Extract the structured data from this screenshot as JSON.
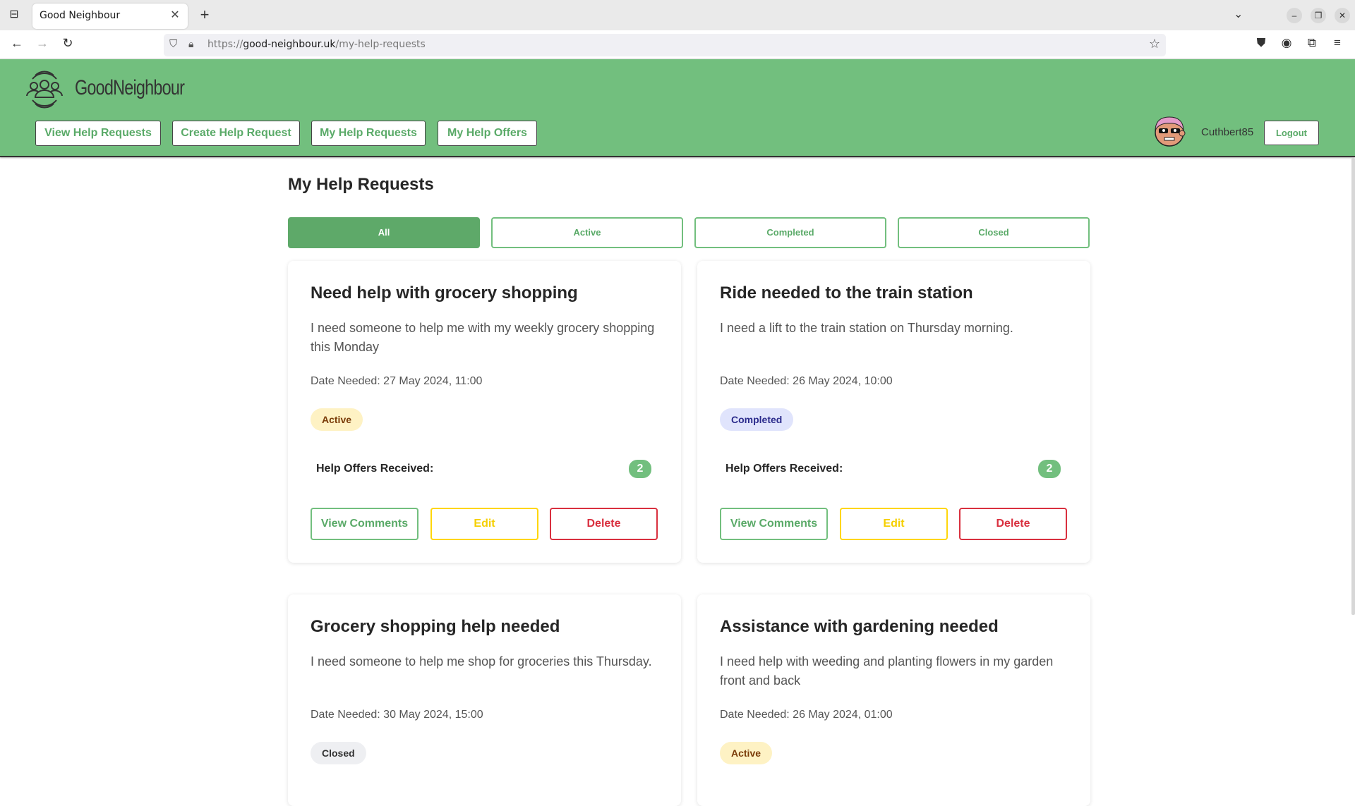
{
  "browser": {
    "tab_title": "Good Neighbour",
    "url_scheme": "https://",
    "url_host": "good-neighbour.uk",
    "url_path": "/my-help-requests"
  },
  "header": {
    "brand": "GoodNeighbour",
    "nav": [
      {
        "label": "View Help Requests"
      },
      {
        "label": "Create Help Request"
      },
      {
        "label": "My Help Requests"
      },
      {
        "label": "My Help Offers"
      }
    ],
    "username": "Cuthbert85",
    "logout_label": "Logout"
  },
  "main": {
    "title": "My Help Requests",
    "filters": [
      {
        "label": "All",
        "selected": true
      },
      {
        "label": "Active",
        "selected": false
      },
      {
        "label": "Completed",
        "selected": false
      },
      {
        "label": "Closed",
        "selected": false
      }
    ],
    "offers_label": "Help Offers Received:",
    "buttons": {
      "view": "View Comments",
      "edit": "Edit",
      "delete": "Delete"
    },
    "requests": [
      {
        "title": "Need help with grocery shopping",
        "description": "I need someone to help me with my weekly grocery shopping this Monday",
        "date": "Date Needed: 27 May 2024, 11:00",
        "status": "Active",
        "offers": "2"
      },
      {
        "title": "Ride needed to the train station",
        "description": "I need a lift to the train station on Thursday morning.",
        "date": "Date Needed: 26 May 2024, 10:00",
        "status": "Completed",
        "offers": "2"
      },
      {
        "title": "Grocery shopping help needed",
        "description": "I need someone to help me shop for groceries this Thursday.",
        "date": "Date Needed: 30 May 2024, 15:00",
        "status": "Closed"
      },
      {
        "title": "Assistance with gardening needed",
        "description": "I need help with weeding and planting flowers in my garden front and back",
        "date": "Date Needed: 26 May 2024, 01:00",
        "status": "Active"
      }
    ]
  },
  "colors": {
    "brand_green": "#72bf7e",
    "active_filter": "#5ea969",
    "edit_yellow": "#ffd60a",
    "delete_red": "#d9303f"
  }
}
